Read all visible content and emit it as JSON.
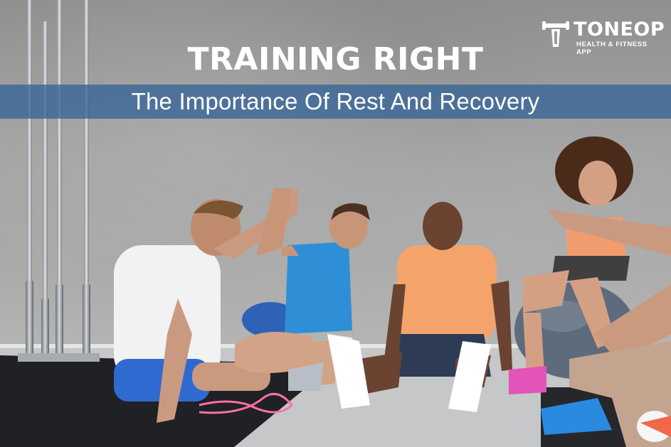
{
  "headline": {
    "title": "TRAINING RIGHT",
    "subtitle": "The Importance Of Rest And Recovery"
  },
  "brand": {
    "name": "TONEOP",
    "tagline": "HEALTH & FITNESS APP"
  },
  "colors": {
    "banner": "#36649a",
    "title_text": "#ffffff",
    "wall": "#a3a4a3",
    "mat": "#1f2124"
  }
}
